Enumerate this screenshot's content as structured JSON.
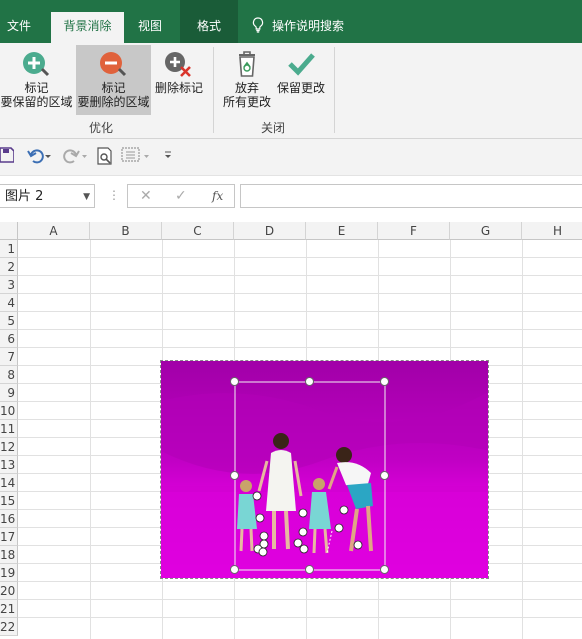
{
  "ribbon_tabs": [
    {
      "label": "文件"
    },
    {
      "label": "背景消除",
      "active": true
    },
    {
      "label": "视图"
    },
    {
      "label": "格式"
    }
  ],
  "tell_me": "操作说明搜索",
  "ribbon": {
    "groups": [
      {
        "label": "优化",
        "buttons": [
          {
            "label": "标记\n要保留的区域",
            "icon": "plus-circle-icon"
          },
          {
            "label": "标记\n要删除的区域",
            "icon": "minus-circle-icon",
            "selected": true
          },
          {
            "label": "删除标记",
            "icon": "delete-mark-icon"
          }
        ]
      },
      {
        "label": "关闭",
        "buttons": [
          {
            "label": "放弃\n所有更改",
            "icon": "recycle-bin-icon"
          },
          {
            "label": "保留更改",
            "icon": "checkmark-icon"
          }
        ]
      }
    ]
  },
  "name_box": "图片 2",
  "formula_input": "",
  "columns": [
    "A",
    "B",
    "C",
    "D",
    "E",
    "F",
    "G",
    "H"
  ],
  "rows": [
    "1",
    "2",
    "3",
    "4",
    "5",
    "6",
    "7",
    "8",
    "9",
    "10",
    "11",
    "12",
    "13",
    "14",
    "15",
    "16",
    "17",
    "18",
    "19",
    "20",
    "21",
    "22"
  ],
  "colors": {
    "excel_green": "#217346",
    "remove_magenta": "#cc00cc",
    "ribbon_bg": "#f3f3f3"
  }
}
